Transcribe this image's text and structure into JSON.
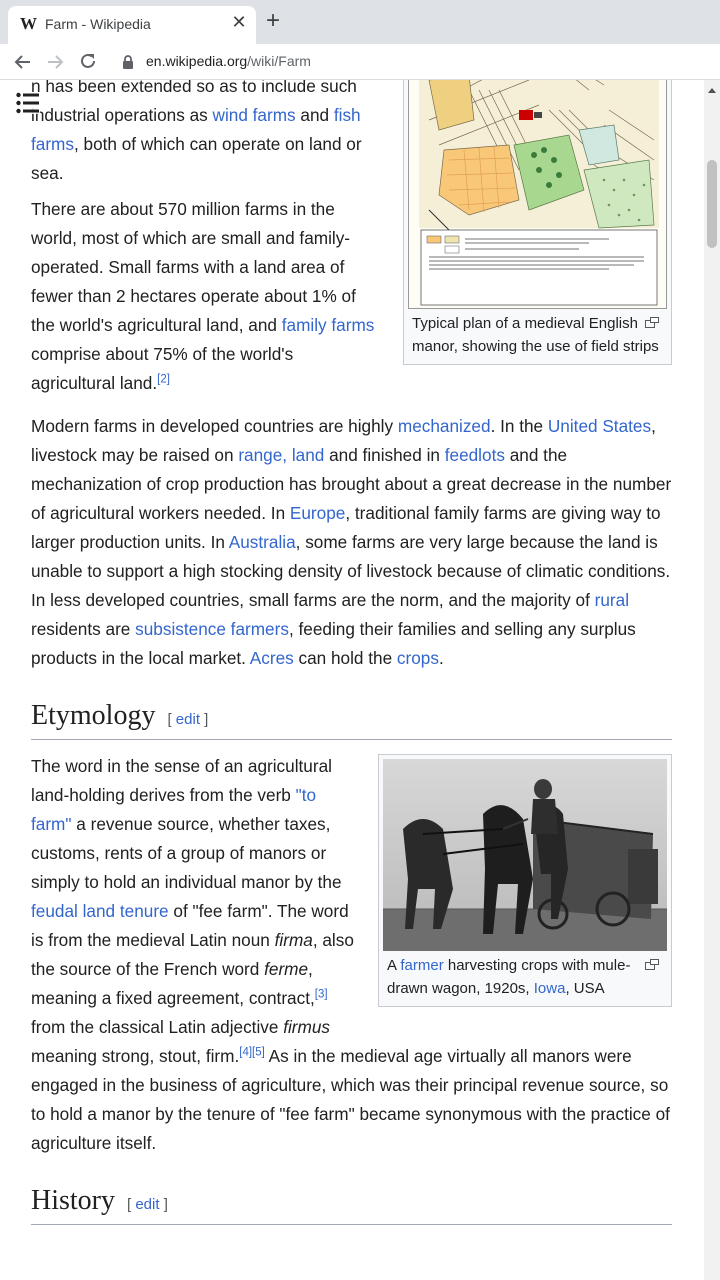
{
  "browser": {
    "tab_title": "Farm - Wikipedia",
    "tab_favicon": "W",
    "tab_close": "✕",
    "new_tab": "+",
    "url_host": "en.wikipedia.org",
    "url_path": "/wiki/Farm"
  },
  "article": {
    "p1": {
      "t1": "n has been extended so as to include ",
      "t1b": "such industrial operations as ",
      "l1": "wind farms",
      "t2": " and ",
      "l2": "fish farms",
      "t3": ", both of which can operate on land or sea."
    },
    "p2": {
      "t1": "There are about 570 million farms in the world, most of which are small and family-operated. Small farms with a land area of fewer than 2 hectares operate about 1% of the world's agricultural land, and ",
      "l1": "family farms",
      "t2": " comprise about 75% of the world's agricultural land.",
      "ref": "[2]"
    },
    "p3": {
      "t1": "Modern farms in developed countries are highly ",
      "l1": "mechanized",
      "t2": ". In the ",
      "l2": "United States",
      "t3": ", livestock may be raised on ",
      "l3": "range, land",
      "t4": " and finished in ",
      "l4": "feedlots",
      "t5": " and the mechanization of crop production has brought about a great decrease in the number of agricultural workers needed. In ",
      "l5": "Europe",
      "t6": ", traditional family farms are giving way to larger production units. In ",
      "l6": "Australia",
      "t7": ", some farms are very large because the land is unable to support a high stocking density of livestock because of climatic conditions. In less developed countries, small farms are the norm, and the majority of ",
      "l7": "rural",
      "t8": " residents are ",
      "l8": "subsistence farmers",
      "t9": ", feeding their families and selling any surplus products in the local market. ",
      "l9": "Acres",
      "t10": " can hold the ",
      "l10": "crops",
      "t11": "."
    },
    "fig1_caption": "Typical plan of a medieval English manor, showing the use of field strips",
    "etymology": {
      "heading": "Etymology",
      "edit_open": "[ ",
      "edit_label": "edit",
      "edit_close": " ]",
      "t1": "The word in the sense of an agricultural land-holding derives from the verb ",
      "l1": "\"to farm\"",
      "t2": " a revenue source, whether taxes, customs, rents of a group of manors or simply to hold an individual manor by the ",
      "l2": "feudal land tenure",
      "t3": " of \"fee farm\". The word is from the medieval Latin noun ",
      "i1": "firma",
      "t4": ", also the source of the French word ",
      "i2": "ferme",
      "t5": ", meaning a fixed agreement, contract,",
      "ref1": "[3]",
      "t6": " from the classical Latin adjective ",
      "i3": "firmus",
      "t7": " meaning strong, stout, firm.",
      "ref2": "[4]",
      "ref3": "[5]",
      "t8": " As in the medieval age virtually all manors were engaged in the business of agriculture, which was their principal revenue source, so to hold a manor by the tenure of \"fee farm\" became synonymous with the practice of agriculture itself."
    },
    "fig2": {
      "c1": "A ",
      "l1": "farmer",
      "c2": " harvesting crops with mule-drawn wagon, 1920s, ",
      "l2": "Iowa",
      "c3": ", USA"
    },
    "history": {
      "heading": "History",
      "edit_open": "[ ",
      "edit_label": "edit",
      "edit_close": " ]"
    }
  },
  "colors": {
    "link": "#3366cc",
    "text": "#202122"
  }
}
